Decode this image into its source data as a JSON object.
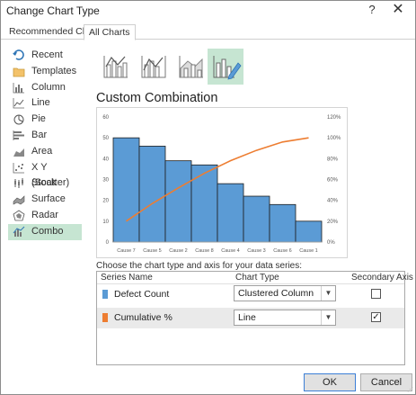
{
  "window": {
    "title": "Change Chart Type",
    "help_icon": "help-icon",
    "close_icon": "close-icon"
  },
  "tabs": [
    {
      "label": "Recommended Charts"
    },
    {
      "label": "All Charts"
    }
  ],
  "sidebar": {
    "items": [
      {
        "label": "Recent",
        "icon": "recent-icon"
      },
      {
        "label": "Templates",
        "icon": "folder-icon"
      },
      {
        "label": "Column",
        "icon": "column-chart-icon"
      },
      {
        "label": "Line",
        "icon": "line-chart-icon"
      },
      {
        "label": "Pie",
        "icon": "pie-chart-icon"
      },
      {
        "label": "Bar",
        "icon": "bar-chart-icon"
      },
      {
        "label": "Area",
        "icon": "area-chart-icon"
      },
      {
        "label": "X Y (Scatter)",
        "icon": "scatter-chart-icon"
      },
      {
        "label": "Stock",
        "icon": "stock-chart-icon"
      },
      {
        "label": "Surface",
        "icon": "surface-chart-icon"
      },
      {
        "label": "Radar",
        "icon": "radar-chart-icon"
      },
      {
        "label": "Combo",
        "icon": "combo-chart-icon"
      }
    ],
    "selected": "Combo"
  },
  "combo_types": [
    "clustered-column-line-icon",
    "clustered-column-line-secondary-icon",
    "stacked-area-column-icon",
    "custom-combination-icon"
  ],
  "section_title": "Custom Combination",
  "chart_data": {
    "type": "bar",
    "categories": [
      "Cause 7",
      "Cause 5",
      "Cause 2",
      "Cause 8",
      "Cause 4",
      "Cause 3",
      "Cause 6",
      "Cause 1"
    ],
    "series": [
      {
        "values": [
          50,
          46,
          39,
          37,
          28,
          22,
          18,
          10
        ],
        "color": "#5b9bd5",
        "kind": "column",
        "axis": "primary"
      },
      {
        "values": [
          20,
          37,
          52,
          66,
          78,
          88,
          96,
          100
        ],
        "color": "#ed7d31",
        "kind": "line",
        "axis": "secondary"
      }
    ],
    "y_ticks": [
      "0",
      "10",
      "20",
      "30",
      "40",
      "50",
      "60"
    ],
    "y2_ticks": [
      "0%",
      "20%",
      "40%",
      "60%",
      "80%",
      "100%",
      "120%"
    ],
    "ylim": [
      0,
      60
    ],
    "y2lim": [
      0,
      120
    ],
    "grid": false
  },
  "choose_label": "Choose the chart type and axis for your data series:",
  "table": {
    "headers": {
      "name": "Series Name",
      "type": "Chart Type",
      "secondary": "Secondary Axis"
    },
    "rows": [
      {
        "name": "Defect Count",
        "color": "#5b9bd5",
        "chart_type": "Clustered Column",
        "secondary": ""
      },
      {
        "name": "Cumulative %",
        "color": "#ed7d31",
        "chart_type": "Line",
        "secondary": "✓"
      }
    ]
  },
  "buttons": {
    "ok": "OK",
    "cancel": "Cancel"
  }
}
